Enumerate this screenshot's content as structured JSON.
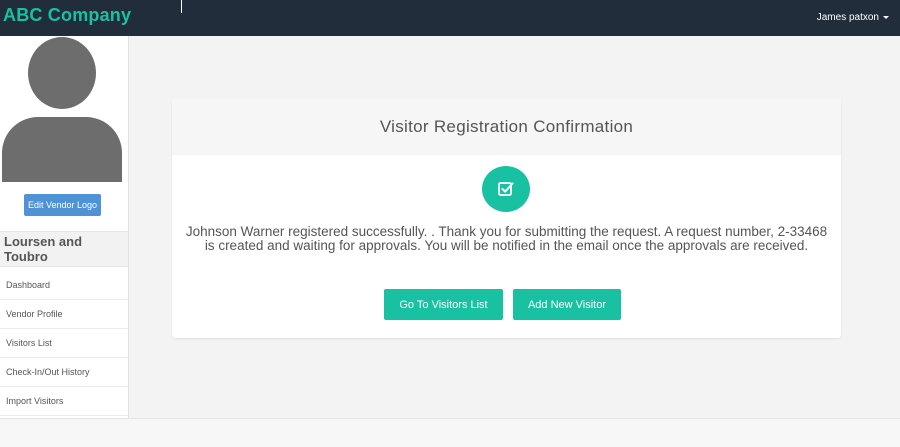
{
  "header": {
    "brand": "ABC Company",
    "user_name": "James patxon",
    "colors": {
      "bar": "#222d3b",
      "brand": "#19c1a3"
    }
  },
  "sidebar": {
    "avatar_icon": "user-silhouette-icon",
    "edit_logo_label": "Edit Vendor Logo",
    "vendor_name": "Loursen and Toubro",
    "items": [
      {
        "label": "Dashboard"
      },
      {
        "label": "Vendor Profile"
      },
      {
        "label": "Visitors List"
      },
      {
        "label": "Check-In/Out History"
      },
      {
        "label": "Import Visitors"
      }
    ]
  },
  "main": {
    "title": "Visitor Registration Confirmation",
    "icon": "check-square-icon",
    "message": "Johnson Warner registered successfully. . Thank you for submitting the request. A request number, 2-33468 is created and waiting for approvals. You will be notified in the email once the approvals are received.",
    "buttons": {
      "visitors_list": "Go To Visitors List",
      "add_new": "Add New Visitor"
    },
    "accent": "#19c1a3"
  }
}
